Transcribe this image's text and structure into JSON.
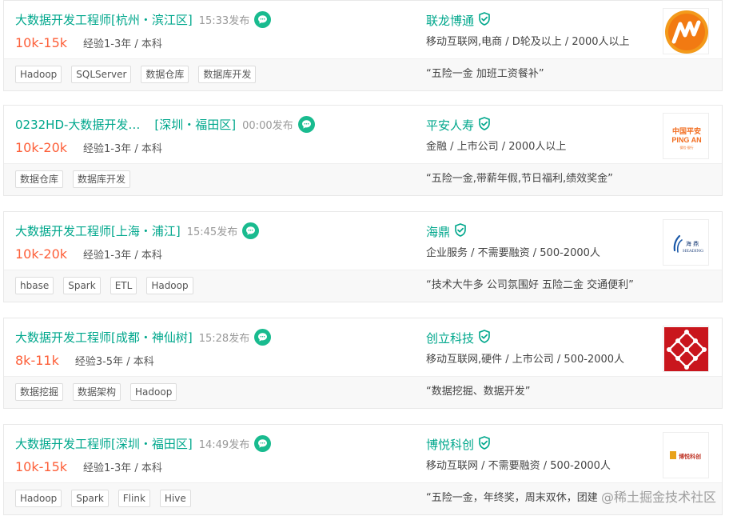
{
  "jobs": [
    {
      "title": "大数据开发工程师",
      "area": "[杭州・滨江区]",
      "time": "15:33发布",
      "salary": "10k-15k",
      "requirement": "经验1-3年 / 本科",
      "company": "联龙博通",
      "industry": "移动互联网,电商 / D轮及以上 / 2000人以上",
      "tags": [
        "Hadoop",
        "SQLServer",
        "数据仓库",
        "数据库开发"
      ],
      "benefit": "“五险一金 加班工资餐补”",
      "logo": "orange-m-logo"
    },
    {
      "title": "0232HD-大数据开发…",
      "area": "[深圳・福田区]",
      "time": "00:00发布",
      "salary": "10k-20k",
      "requirement": "经验1-3年 / 本科",
      "company": "平安人寿",
      "industry": "金融 / 上市公司 / 2000人以上",
      "tags": [
        "数据仓库",
        "数据库开发"
      ],
      "benefit": "“五险一金,带薪年假,节日福利,绩效奖金”",
      "logo": "pingan-logo",
      "logo_text": [
        "中国平安",
        "PING AN",
        "保险·银行"
      ]
    },
    {
      "title": "大数据开发工程师",
      "area": "[上海・浦江]",
      "time": "15:45发布",
      "salary": "10k-20k",
      "requirement": "经验1-3年 / 本科",
      "company": "海鼎",
      "industry": "企业服务 / 不需要融资 / 500-2000人",
      "tags": [
        "hbase",
        "Spark",
        "ETL",
        "Hadoop"
      ],
      "benefit": "“技术大牛多 公司氛围好 五险二金 交通便利”",
      "logo": "heading-logo",
      "logo_text": [
        "海 鼎",
        "HEADING"
      ]
    },
    {
      "title": "大数据开发工程师",
      "area": "[成都・神仙树]",
      "time": "15:28发布",
      "salary": "8k-11k",
      "requirement": "经验3-5年 / 本科",
      "company": "创立科技",
      "industry": "移动互联网,硬件 / 上市公司 / 500-2000人",
      "tags": [
        "数据挖掘",
        "数据架构",
        "Hadoop"
      ],
      "benefit": "“数据挖掘、数据开发”",
      "logo": "red-lattice-logo"
    },
    {
      "title": "大数据开发工程师",
      "area": "[深圳・福田区]",
      "time": "14:49发布",
      "salary": "10k-15k",
      "requirement": "经验1-3年 / 本科",
      "company": "博悦科创",
      "industry": "移动互联网 / 不需要融资 / 500-2000人",
      "tags": [
        "Hadoop",
        "Spark",
        "Flink",
        "Hive"
      ],
      "benefit": "“五险一金，年终奖，周末双休，团建",
      "logo": "boyue-logo",
      "logo_text": [
        "博悦科创"
      ]
    }
  ],
  "watermark": "@稀土掘金技术社区",
  "colors": {
    "title_green": "#00a78c",
    "salary_orange": "#fd5f39",
    "chat_green": "#19bb8f",
    "pingan_orange": "#f26e21",
    "lattice_red": "#c9161d"
  }
}
